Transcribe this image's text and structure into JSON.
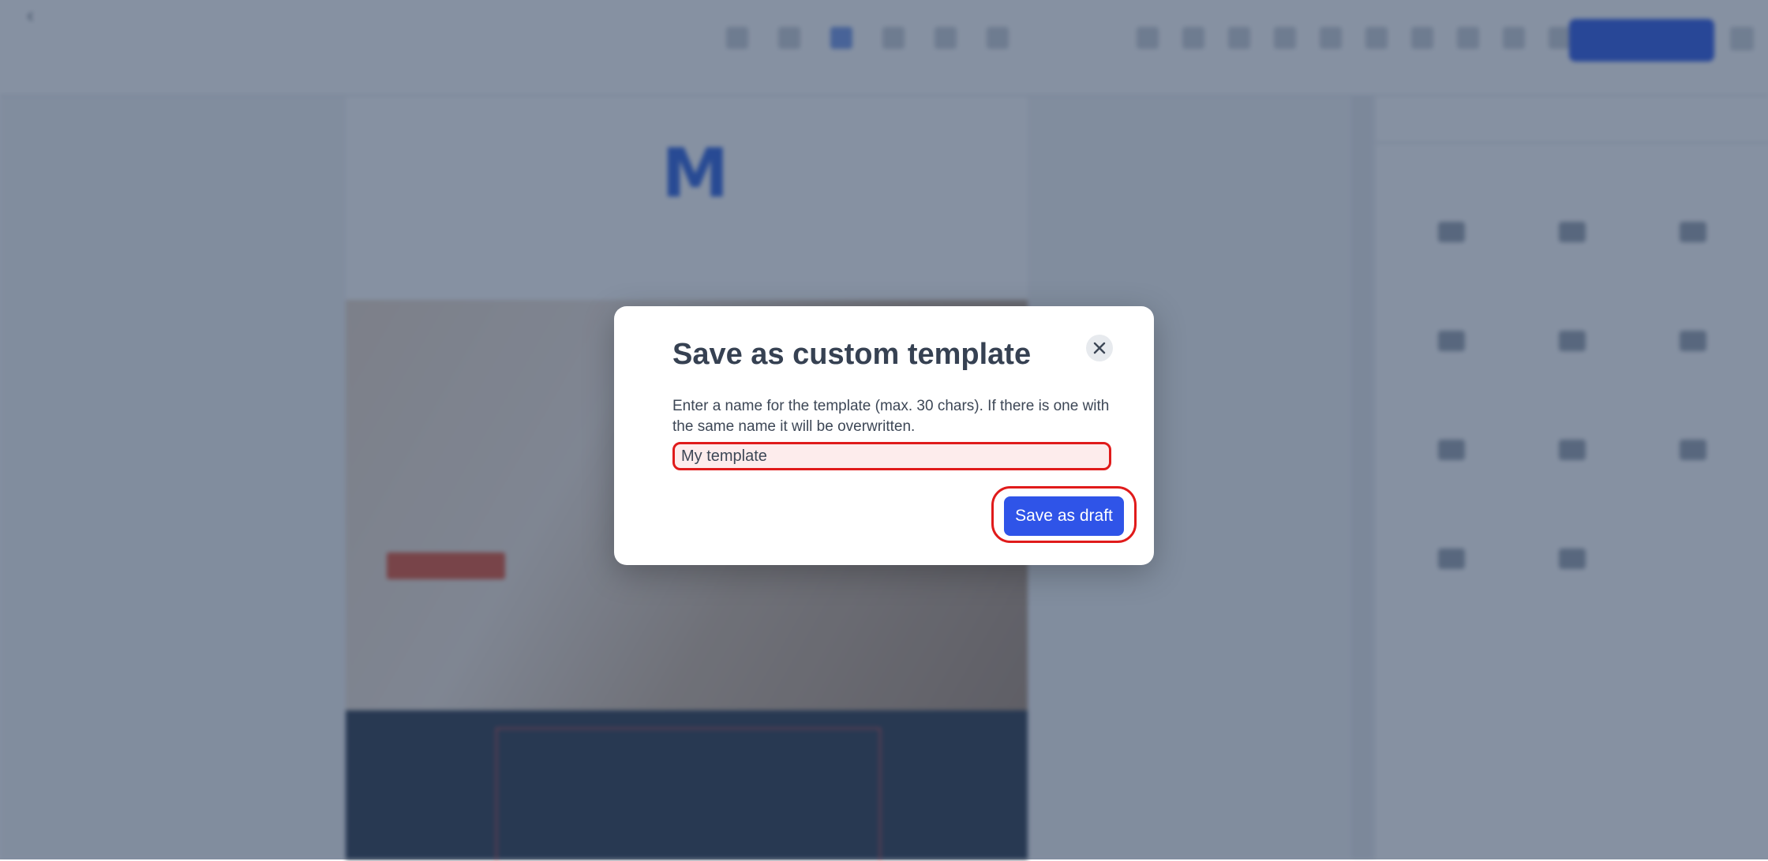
{
  "modal": {
    "title": "Save as custom template",
    "description": "Enter a name for the template (max. 30 chars). If there is one with the same name it will be overwritten.",
    "name_input_value": "My template",
    "save_button_label": "Save as draft",
    "close_icon": "close-icon"
  },
  "colors": {
    "primary_button": "#2f54e8",
    "highlight_outline": "#e01b1b",
    "overlay": "#233755"
  }
}
